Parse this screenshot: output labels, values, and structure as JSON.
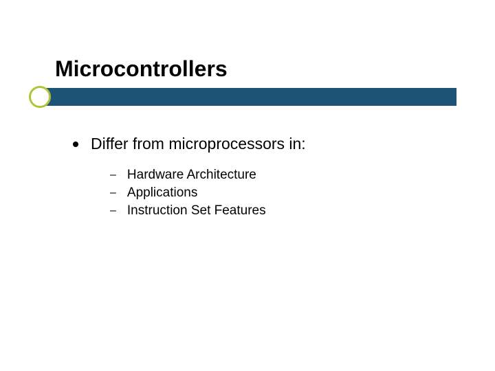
{
  "title": "Microcontrollers",
  "main_point": "Differ from microprocessors in:",
  "sub_points": {
    "item0": "Hardware Architecture",
    "item1": "Applications",
    "item2": "Instruction Set Features"
  }
}
